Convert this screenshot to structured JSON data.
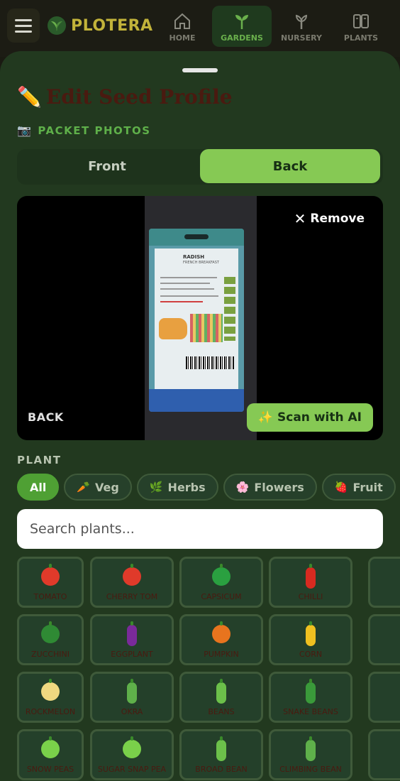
{
  "app": {
    "name": "PLOTERA"
  },
  "nav": [
    {
      "label": "HOME",
      "icon": "home-icon"
    },
    {
      "label": "GARDENS",
      "icon": "sprout-icon",
      "active": true
    },
    {
      "label": "NURSERY",
      "icon": "seedling-icon"
    },
    {
      "label": "PLANTS",
      "icon": "book-icon"
    }
  ],
  "sheet": {
    "title": "Edit Seed Profile",
    "title_icon": "✏️",
    "photos_heading": "PACKET PHOTOS",
    "photos_icon": "📷",
    "tabs": {
      "front": "Front",
      "back": "Back",
      "active": "Back"
    },
    "photo": {
      "remove_label": "Remove",
      "side_label": "BACK",
      "scan_label": "Scan with AI",
      "packet_title": "RADISH",
      "packet_subtitle": "FRENCH BREAKFAST"
    },
    "plant_heading": "PLANT",
    "filters": [
      {
        "label": "All",
        "emoji": "",
        "active": true
      },
      {
        "label": "Veg",
        "emoji": "🥕"
      },
      {
        "label": "Herbs",
        "emoji": "🌿"
      },
      {
        "label": "Flowers",
        "emoji": "🌸"
      },
      {
        "label": "Fruit",
        "emoji": "🍓"
      }
    ],
    "search_placeholder": "Search plants...",
    "plants": [
      {
        "label": "TOMATO",
        "color": "#e03a2a",
        "shape": "round"
      },
      {
        "label": "CHERRY TOM",
        "color": "#e03a2a",
        "shape": "round"
      },
      {
        "label": "CAPSICUM",
        "color": "#2aa040",
        "shape": "round"
      },
      {
        "label": "CHILLI",
        "color": "#d82a20",
        "shape": "long"
      },
      {
        "label": "",
        "color": "#24402a",
        "shape": "none"
      },
      {
        "label": "ZUCCHINI",
        "color": "#2f8a34",
        "shape": "round"
      },
      {
        "label": "EGGPLANT",
        "color": "#7a2a9a",
        "shape": "long"
      },
      {
        "label": "PUMPKIN",
        "color": "#e8741e",
        "shape": "round"
      },
      {
        "label": "CORN",
        "color": "#f0c020",
        "shape": "long"
      },
      {
        "label": "",
        "color": "#24402a",
        "shape": "none"
      },
      {
        "label": "ROCKMELON",
        "color": "#f0d880",
        "shape": "round"
      },
      {
        "label": "OKRA",
        "color": "#5fb04a",
        "shape": "long"
      },
      {
        "label": "BEANS",
        "color": "#6cc04a",
        "shape": "long"
      },
      {
        "label": "SNAKE BEANS",
        "color": "#3a9a3a",
        "shape": "long"
      },
      {
        "label": "",
        "color": "#24402a",
        "shape": "none"
      },
      {
        "label": "SNOW PEAS",
        "color": "#7ad04a",
        "shape": "round"
      },
      {
        "label": "SUGAR SNAP PEA",
        "color": "#7ad04a",
        "shape": "round"
      },
      {
        "label": "BROAD BEAN",
        "color": "#6cc04a",
        "shape": "long"
      },
      {
        "label": "CLIMBING BEAN",
        "color": "#5fb04a",
        "shape": "long"
      },
      {
        "label": "",
        "color": "#24402a",
        "shape": "none"
      }
    ]
  }
}
